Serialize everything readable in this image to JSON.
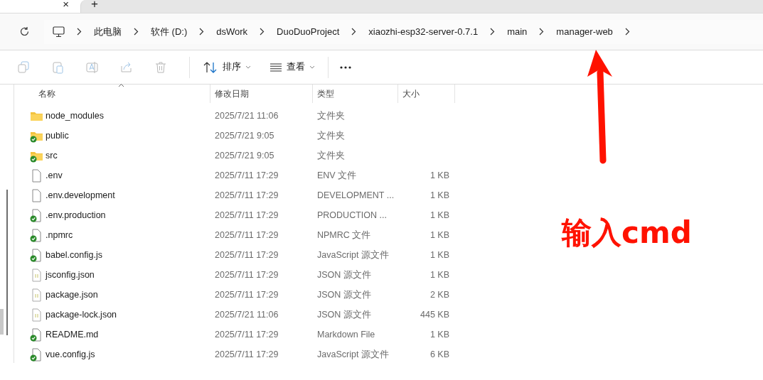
{
  "tab_strip": {
    "close": "×",
    "new_tab": "+"
  },
  "address_bar": {
    "segments": [
      "此电脑",
      "软件 (D:)",
      "dsWork",
      "DuoDuoProject",
      "xiaozhi-esp32-server-0.7.1",
      "main",
      "manager-web"
    ]
  },
  "toolbar": {
    "actions": [
      {
        "kind": "copy",
        "disabled": true
      },
      {
        "kind": "paste",
        "disabled": true
      },
      {
        "kind": "rename",
        "disabled": true
      },
      {
        "kind": "share",
        "disabled": true
      },
      {
        "kind": "delete",
        "disabled": true
      }
    ],
    "sort": "排序",
    "view": "查看"
  },
  "table": {
    "columns": [
      "名称",
      "修改日期",
      "类型",
      "大小"
    ],
    "rows": [
      {
        "name": "node_modules",
        "kind": "folder",
        "synced": false,
        "modified": "2025/7/21 11:06",
        "type": "文件夹"
      },
      {
        "name": "public",
        "kind": "folder",
        "synced": true,
        "modified": "2025/7/21 9:05",
        "type": "文件夹"
      },
      {
        "name": "src",
        "kind": "folder",
        "synced": true,
        "modified": "2025/7/21 9:05",
        "type": "文件夹"
      },
      {
        "name": ".env",
        "kind": "file",
        "synced": false,
        "modified": "2025/7/11 17:29",
        "type": "ENV 文件",
        "size": "1 KB"
      },
      {
        "name": ".env.development",
        "kind": "file",
        "synced": false,
        "modified": "2025/7/11 17:29",
        "type": "DEVELOPMENT ...",
        "size": "1 KB"
      },
      {
        "name": ".env.production",
        "kind": "file",
        "synced": true,
        "modified": "2025/7/11 17:29",
        "type": "PRODUCTION ...",
        "size": "1 KB"
      },
      {
        "name": ".npmrc",
        "kind": "file",
        "synced": true,
        "modified": "2025/7/11 17:29",
        "type": "NPMRC 文件",
        "size": "1 KB"
      },
      {
        "name": "babel.config.js",
        "kind": "file",
        "synced": true,
        "modified": "2025/7/11 17:29",
        "type": "JavaScript 源文件",
        "size": "1 KB"
      },
      {
        "name": "jsconfig.json",
        "kind": "json",
        "synced": false,
        "modified": "2025/7/11 17:29",
        "type": "JSON 源文件",
        "size": "1 KB"
      },
      {
        "name": "package.json",
        "kind": "json",
        "synced": false,
        "modified": "2025/7/11 17:29",
        "type": "JSON 源文件",
        "size": "2 KB"
      },
      {
        "name": "package-lock.json",
        "kind": "json",
        "synced": false,
        "modified": "2025/7/21 11:06",
        "type": "JSON 源文件",
        "size": "445 KB"
      },
      {
        "name": "README.md",
        "kind": "file",
        "synced": true,
        "modified": "2025/7/11 17:29",
        "type": "Markdown File",
        "size": "1 KB"
      },
      {
        "name": "vue.config.js",
        "kind": "file",
        "synced": true,
        "modified": "2025/7/11 17:29",
        "type": "JavaScript 源文件",
        "size": "6 KB"
      }
    ]
  },
  "annotation": {
    "text": "输入cmd"
  }
}
